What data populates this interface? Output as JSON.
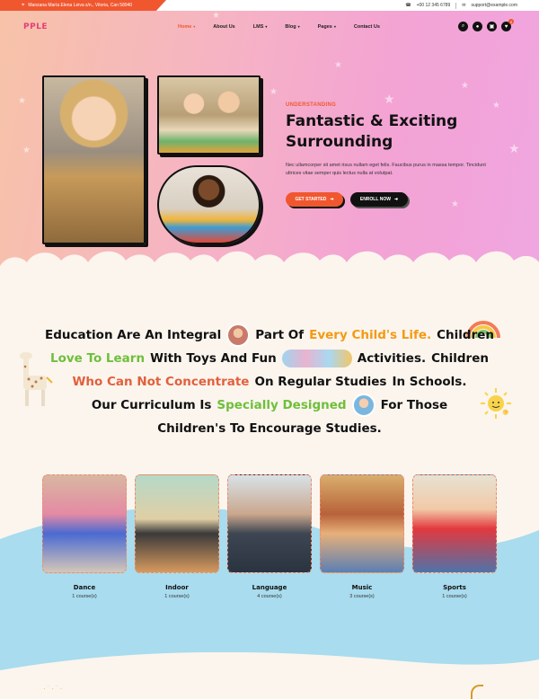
{
  "topbar": {
    "address": "Manzana María Elena Leiva s/n., Vitoria, Can 58940",
    "phone": "+00 12 345 6789",
    "email": "support@example.com"
  },
  "logo": {
    "text": "PPLE"
  },
  "nav": {
    "items": [
      {
        "label": "Home",
        "active": true,
        "dropdown": true
      },
      {
        "label": "About Us",
        "active": false,
        "dropdown": false
      },
      {
        "label": "LMS",
        "active": false,
        "dropdown": true
      },
      {
        "label": "Blog",
        "active": false,
        "dropdown": true
      },
      {
        "label": "Pages",
        "active": false,
        "dropdown": true
      },
      {
        "label": "Contact Us",
        "active": false,
        "dropdown": false
      }
    ],
    "icons": [
      "search-icon",
      "user-icon",
      "bag-icon",
      "heart-icon"
    ],
    "wishlist_count": "0"
  },
  "hero": {
    "eyebrow": "UNDERSTANDING",
    "title_line1": "Fantastic & Exciting",
    "title_line2": "Surrounding",
    "description": "Nec ullamcorper sit amet risus nullam eget felis. Faucibus purus in massa tempor. Tincidunt ultrices vitae semper quis lectus nulla at volutpat.",
    "btn_start": "GET STARTED",
    "btn_enroll": "ENROLL NOW"
  },
  "statement": {
    "l1_a": "Education Are An Integral",
    "l1_b": "Part Of",
    "l1_c": "Every Child's Life.",
    "l1_d": "Children",
    "l2_a": "Love To Learn",
    "l2_b": "With Toys And Fun",
    "l2_c": "Activities.",
    "l2_d": "Children",
    "l3_a": "Who Can Not Concentrate",
    "l3_b": "On Regular Studies",
    "l3_c": "In Schools.",
    "l4_a": "Our Curriculum Is",
    "l4_b": "Specially Designed",
    "l4_c": "For Those",
    "l5": "Children's To Encourage Studies."
  },
  "courses": [
    {
      "title": "Dance",
      "count": "1 course(s)"
    },
    {
      "title": "Indoor",
      "count": "1 course(s)"
    },
    {
      "title": "Language",
      "count": "4 course(s)"
    },
    {
      "title": "Music",
      "count": "3 course(s)"
    },
    {
      "title": "Sports",
      "count": "1 course(s)"
    }
  ],
  "colors": {
    "accent": "#f0572f",
    "orange_text": "#f49a12",
    "green_text": "#6fbf3a",
    "red_text": "#e2603c",
    "wave_blue": "#a8dcee",
    "cream": "#fbf5ee"
  }
}
